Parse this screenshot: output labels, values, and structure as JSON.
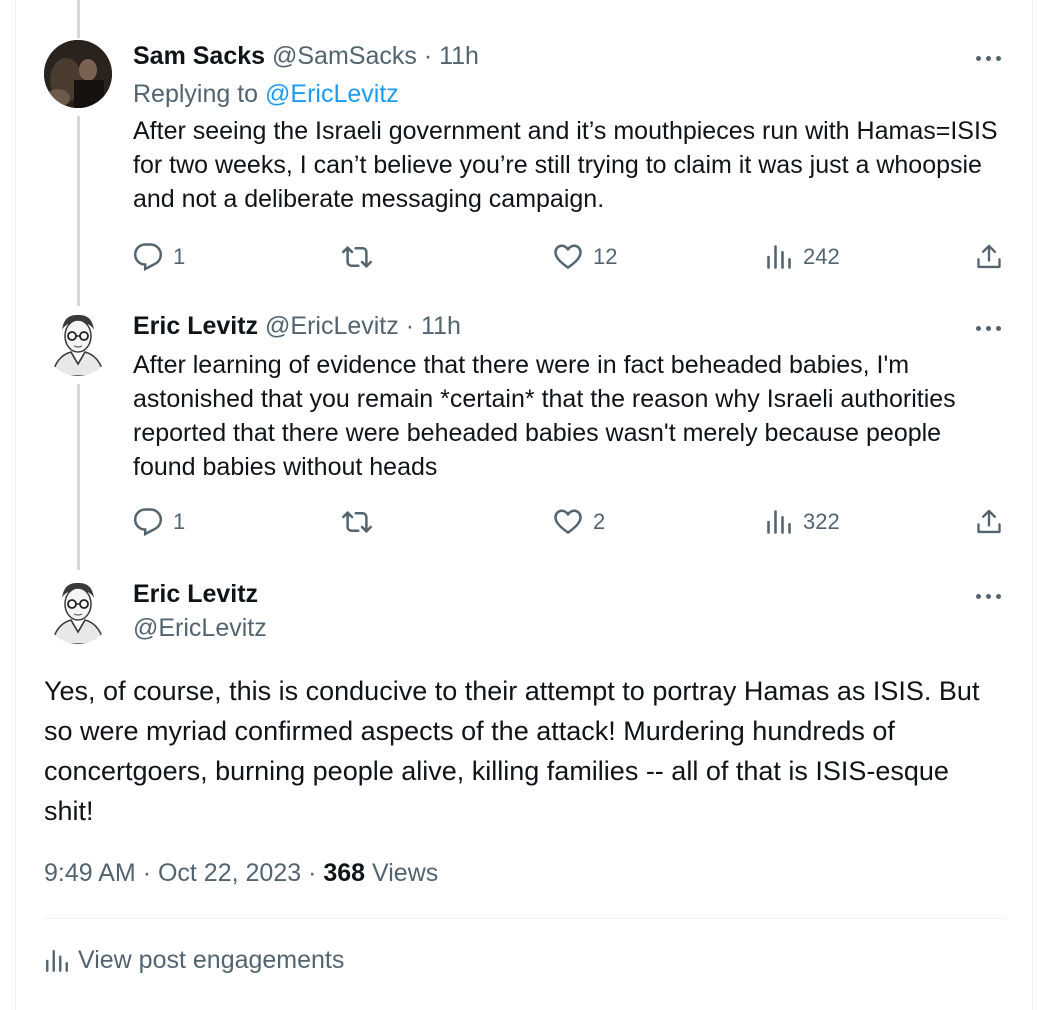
{
  "reply1": {
    "name": "Sam Sacks",
    "handle": "@SamSacks",
    "time": "11h",
    "replying_prefix": "Replying to",
    "replying_to": "@EricLevitz",
    "text": "After seeing the Israeli government and it’s mouthpieces run with Hamas=ISIS for two weeks, I can’t believe you’re still trying to claim it was just a whoopsie and not a deliberate messaging campaign.",
    "stats": {
      "replies": "1",
      "likes": "12",
      "views": "242"
    }
  },
  "reply2": {
    "name": "Eric Levitz",
    "handle": "@EricLevitz",
    "time": "11h",
    "text": "After learning of evidence that there were in fact beheaded babies, I'm astonished that you remain *certain* that the reason why Israeli authorities reported that there were beheaded babies wasn't merely because people found babies without heads",
    "stats": {
      "replies": "1",
      "likes": "2",
      "views": "322"
    }
  },
  "main": {
    "name": "Eric Levitz",
    "handle": "@EricLevitz",
    "text": "Yes, of course, this is conducive to their attempt to portray Hamas as ISIS. But so were myriad confirmed aspects of the attack! Murdering hundreds of concertgoers, burning people alive, killing families -- all of that is ISIS-esque shit!",
    "time": "9:49 AM",
    "date": "Oct 22, 2023",
    "views_count": "368",
    "views_label": "Views",
    "engagements_label": "View post engagements"
  },
  "separator": "·",
  "icons": [
    "reply-icon",
    "repost-icon",
    "like-icon",
    "views-icon",
    "share-icon",
    "more-icon"
  ],
  "colors": {
    "accent": "#1d9bf0",
    "muted": "#536471",
    "text": "#0f1419",
    "line": "#cfd9de"
  }
}
